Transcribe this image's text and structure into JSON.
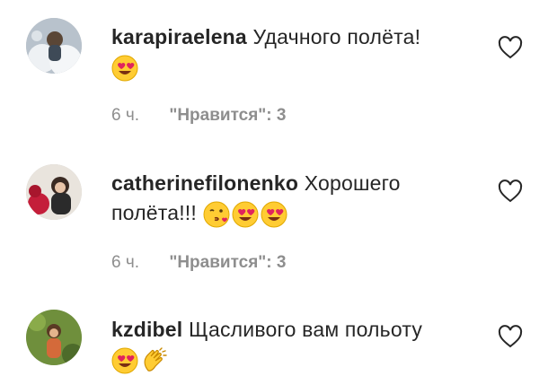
{
  "comments": [
    {
      "username": "karapiraelena",
      "text": "Удачного полёта!",
      "emojis": [
        "heart-eyes"
      ],
      "time": "6 ч.",
      "likes": "\"Нравится\": 3"
    },
    {
      "username": "catherinefilonenko",
      "text": "Хорошего полёта!!!",
      "emojis": [
        "kissing-heart",
        "heart-eyes",
        "heart-eyes"
      ],
      "time": "6 ч.",
      "likes": "\"Нравится\": 3"
    },
    {
      "username": "kzdibel",
      "text": "Щасливого вам польоту",
      "emojis": [
        "heart-eyes",
        "clapping-hands"
      ],
      "time": "",
      "likes": ""
    }
  ]
}
